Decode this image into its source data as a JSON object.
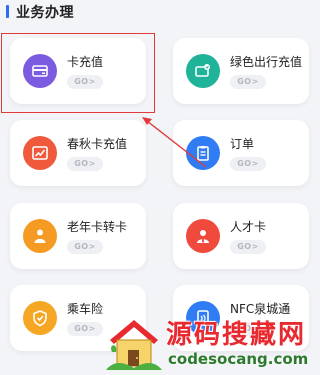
{
  "section": {
    "title": "业务办理"
  },
  "cards": [
    {
      "label": "卡充值",
      "go": "GO>",
      "icon": "card-icon",
      "color": "#7b5ce0"
    },
    {
      "label": "绿色出行充值",
      "go": "GO>",
      "icon": "green-travel-icon",
      "color": "#1fb39a"
    },
    {
      "label": "春秋卡充值",
      "go": "GO>",
      "icon": "chart-card-icon",
      "color": "#ef5a3d"
    },
    {
      "label": "订单",
      "go": "GO>",
      "icon": "order-icon",
      "color": "#2f7cf5"
    },
    {
      "label": "老年卡转卡",
      "go": "GO>",
      "icon": "elder-icon",
      "color": "#f59a23"
    },
    {
      "label": "人才卡",
      "go": "GO>",
      "icon": "talent-icon",
      "color": "#ef4a3c"
    },
    {
      "label": "乘车险",
      "go": "GO>",
      "icon": "shield-icon",
      "color": "#f5a623"
    },
    {
      "label": "NFC泉城通",
      "go": "GO>",
      "icon": "nfc-icon",
      "color": "#2f7cf5"
    }
  ],
  "watermark": {
    "title": "源码搜藏网",
    "domain": "codesocang.com"
  }
}
